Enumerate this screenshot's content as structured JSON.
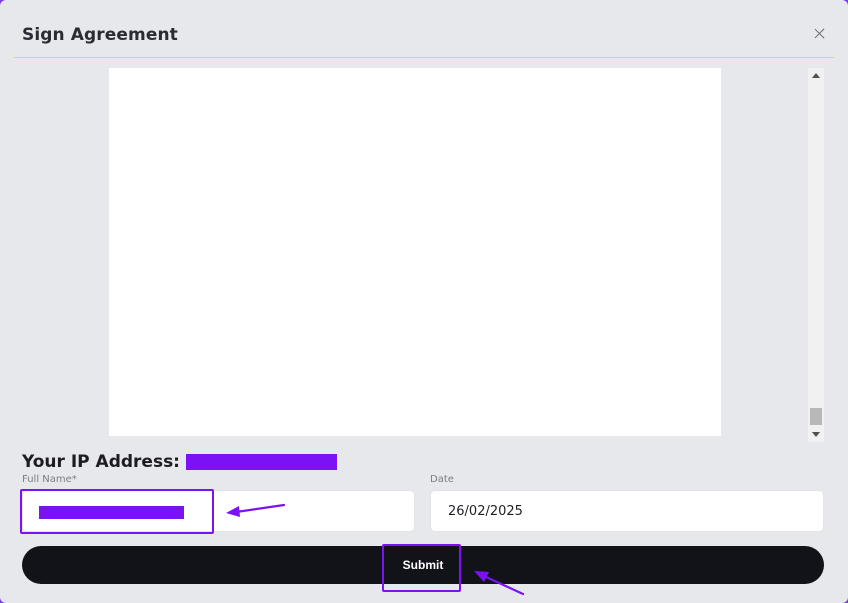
{
  "dialog": {
    "title": "Sign Agreement",
    "close_icon": "close-icon"
  },
  "ip": {
    "label": "Your IP Address:"
  },
  "form": {
    "full_name_label": "Full Name*",
    "date_label": "Date",
    "date_value": "26/02/2025"
  },
  "actions": {
    "submit_label": "Submit"
  },
  "colors": {
    "accent": "#7a12f5",
    "button_bg": "#121219",
    "divider": "#f0c89a"
  }
}
